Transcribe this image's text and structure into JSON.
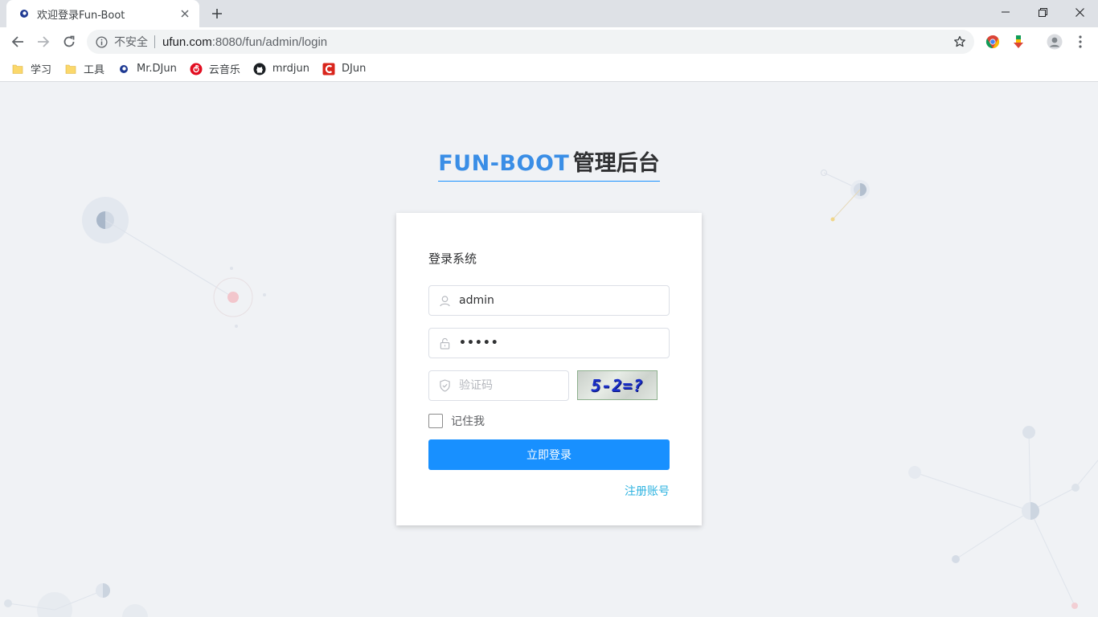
{
  "browser": {
    "tab": {
      "title": "欢迎登录Fun-Boot"
    },
    "omnibox": {
      "security": "不安全",
      "host": "ufun.com",
      "path": ":8080/fun/admin/login"
    },
    "bookmarks": [
      {
        "label": "学习",
        "icon": "folder-icon"
      },
      {
        "label": "工具",
        "icon": "folder-icon"
      },
      {
        "label": "Mr.DJun",
        "icon": "site-icon"
      },
      {
        "label": "云音乐",
        "icon": "netease-music-icon"
      },
      {
        "label": "mrdjun",
        "icon": "github-icon"
      },
      {
        "label": "DJun",
        "icon": "csdn-icon"
      }
    ]
  },
  "page": {
    "title": {
      "brand": "FUN-BOOT",
      "sub": "管理后台"
    },
    "login": {
      "heading": "登录系统",
      "username_value": "admin",
      "password_value": "•••••",
      "captcha_placeholder": "验证码",
      "captcha_text": "5-2=?",
      "remember_label": "记住我",
      "submit_label": "立即登录",
      "register_label": "注册账号"
    }
  },
  "colors": {
    "accent": "#1890ff",
    "brand_title": "#3a8ee6",
    "link": "#2db3e0"
  }
}
